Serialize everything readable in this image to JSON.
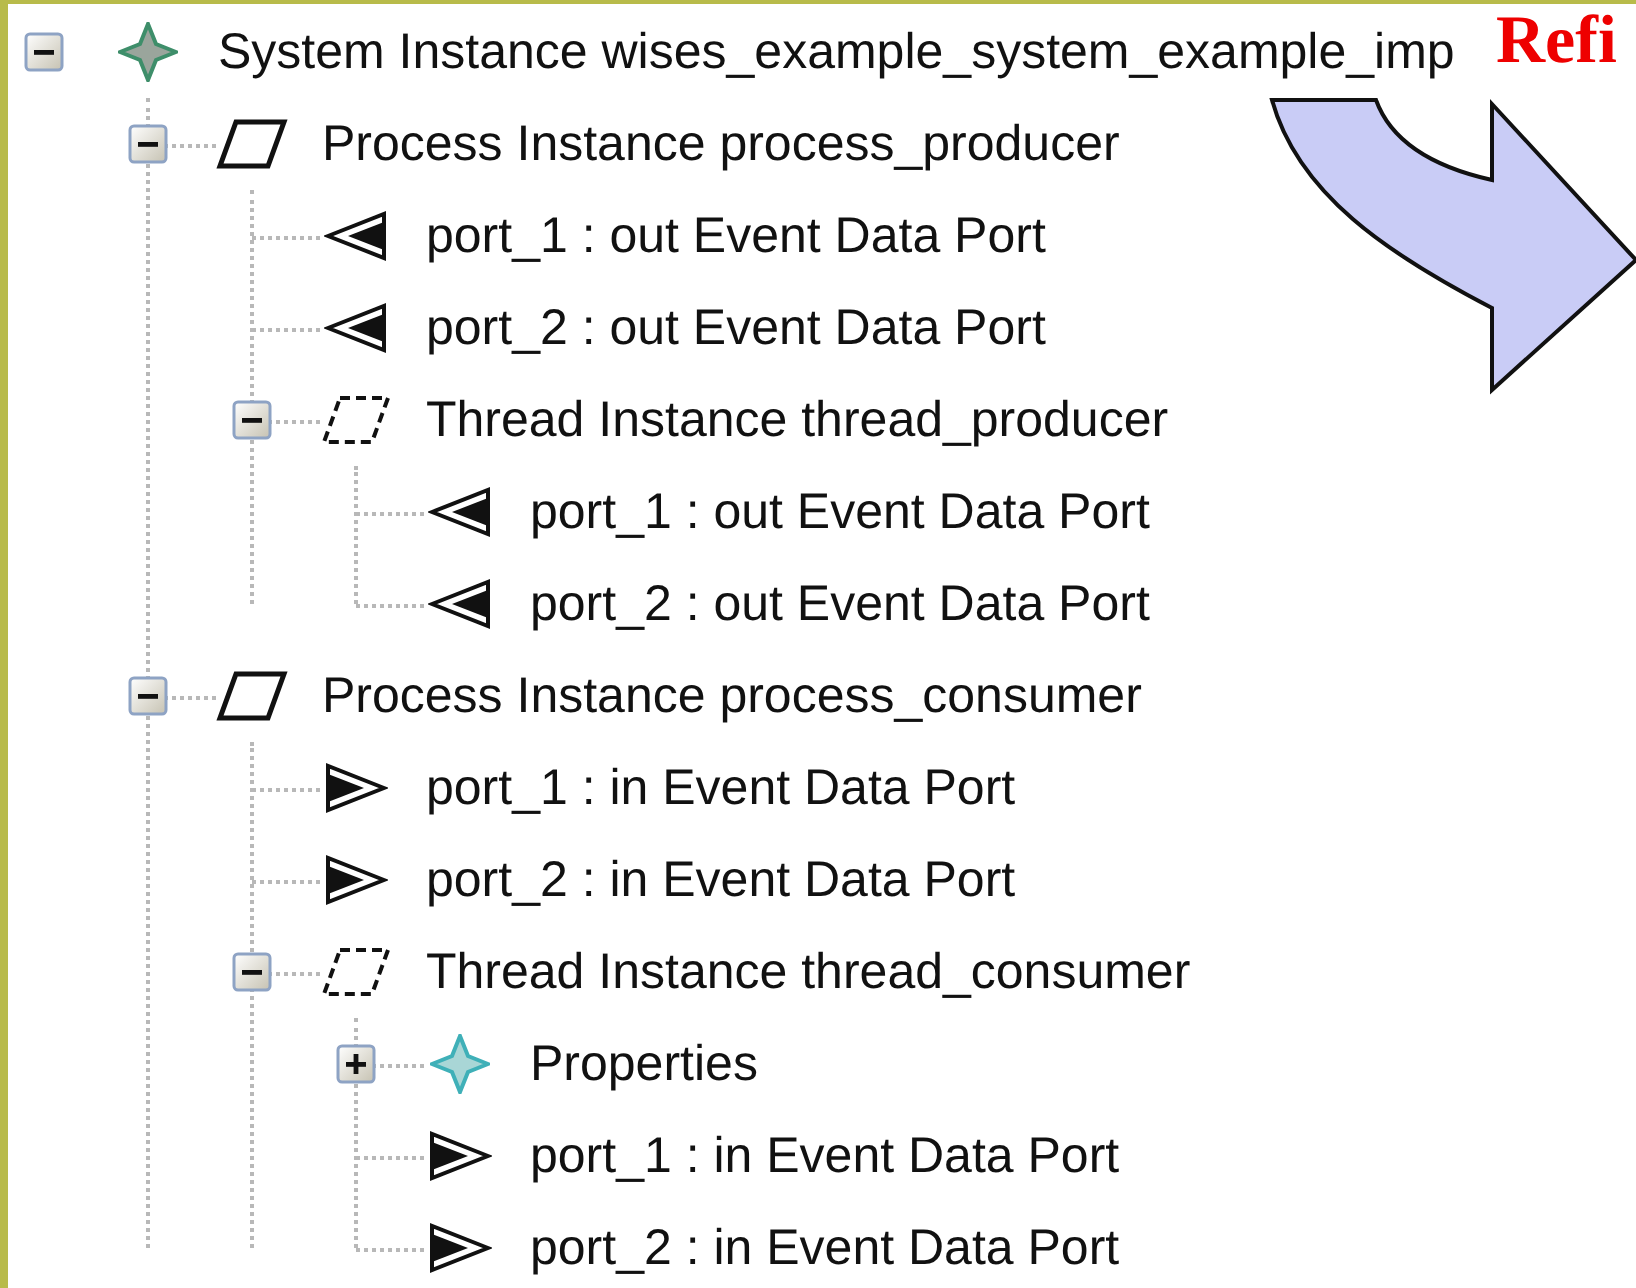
{
  "tree": [
    {
      "kind": "system",
      "label": "System Instance wises_example_system_example_imp",
      "expanded": true,
      "children": [
        {
          "kind": "process",
          "label": "Process Instance process_producer",
          "expanded": true,
          "children": [
            {
              "kind": "port_out",
              "label": "port_1 : out Event Data Port"
            },
            {
              "kind": "port_out",
              "label": "port_2 : out Event Data Port"
            },
            {
              "kind": "thread",
              "label": "Thread Instance thread_producer",
              "expanded": true,
              "children": [
                {
                  "kind": "port_out",
                  "label": "port_1 : out Event Data Port"
                },
                {
                  "kind": "port_out",
                  "label": "port_2 : out Event Data Port"
                }
              ]
            }
          ]
        },
        {
          "kind": "process",
          "label": "Process Instance process_consumer",
          "expanded": true,
          "children": [
            {
              "kind": "port_in",
              "label": "port_1 : in Event Data Port"
            },
            {
              "kind": "port_in",
              "label": "port_2 : in Event Data Port"
            },
            {
              "kind": "thread",
              "label": "Thread Instance thread_consumer",
              "expanded": true,
              "children": [
                {
                  "kind": "properties",
                  "label": "Properties",
                  "expanded": false
                },
                {
                  "kind": "port_in",
                  "label": "port_1 : in Event Data Port"
                },
                {
                  "kind": "port_in",
                  "label": "port_2 : in Event Data Port"
                }
              ]
            }
          ]
        }
      ]
    }
  ],
  "overlay": {
    "title": "Refi"
  }
}
